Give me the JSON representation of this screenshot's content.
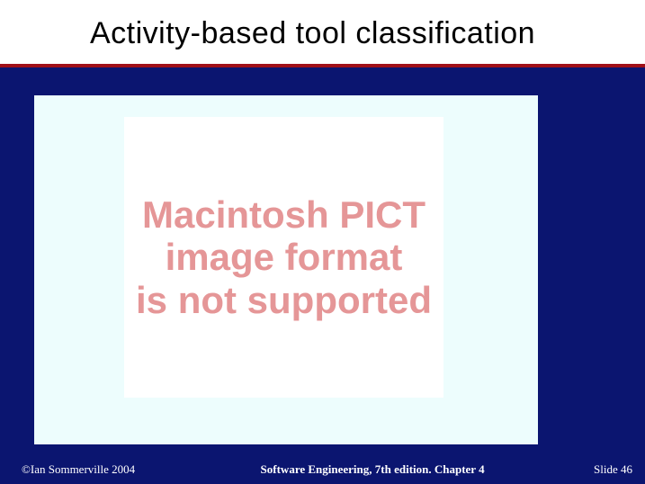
{
  "slide": {
    "title": "Activity-based tool classification",
    "placeholder": {
      "line1": "Macintosh PICT",
      "line2": "image format",
      "line3": "is not supported"
    },
    "footer": {
      "copyright": "©Ian Sommerville 2004",
      "center": "Software Engineering, 7th edition. Chapter 4",
      "slide_label": "Slide ",
      "slide_number": "46"
    }
  }
}
